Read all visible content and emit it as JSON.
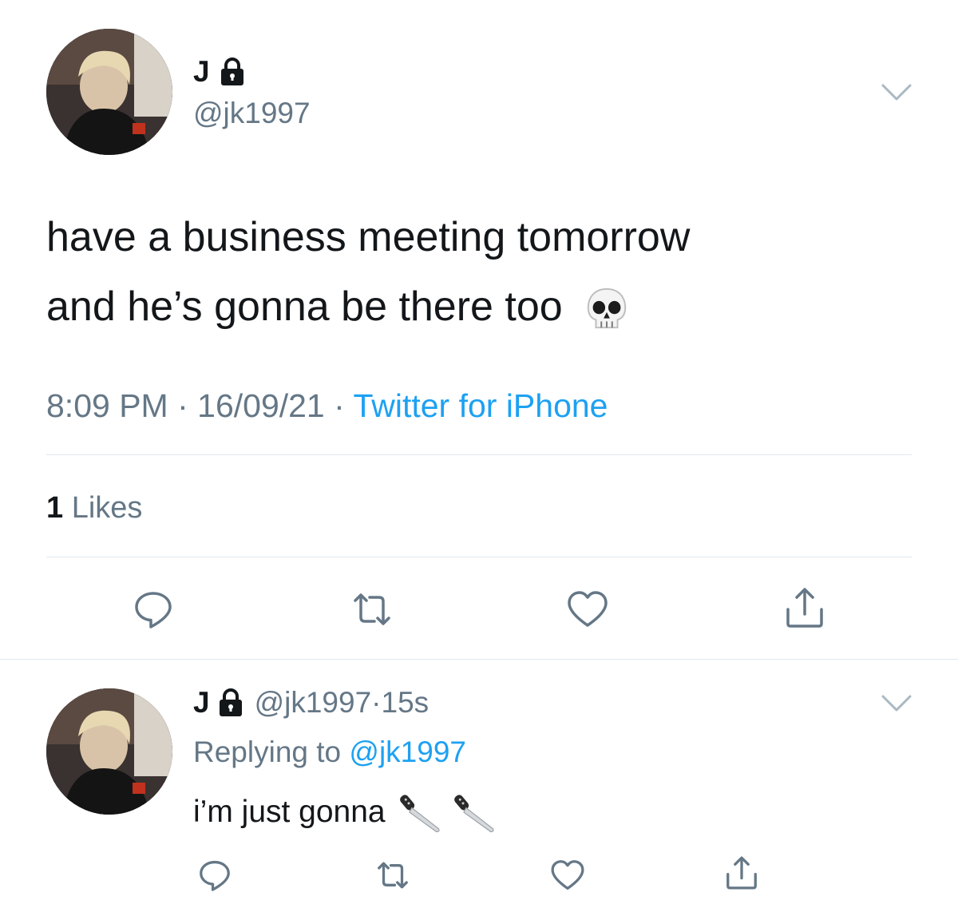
{
  "main_tweet": {
    "display_name": "J",
    "handle": "@jk1997",
    "text_line_1": "have a business meeting tomorrow",
    "text_line_2": "and he’s gonna be there too",
    "emoji": "skull-emoji",
    "time": "8:09 PM",
    "separator": " · ",
    "date": "16/09/21",
    "source": "Twitter for iPhone",
    "likes_count": "1",
    "likes_label": "Likes",
    "actions": [
      "reply-icon",
      "retweet-icon",
      "like-icon",
      "share-icon"
    ]
  },
  "reply_tweet": {
    "display_name": "J",
    "handle": "@jk1997",
    "separator": " · ",
    "age": "15s",
    "replying_label": "Replying to ",
    "replying_to": "@jk1997",
    "text": "i’m just gonna ",
    "emoji": [
      "knife-emoji",
      "knife-emoji"
    ],
    "actions": [
      "reply-icon",
      "retweet-icon",
      "like-icon",
      "share-icon"
    ]
  },
  "colors": {
    "text_primary": "#14171a",
    "text_secondary": "#657786",
    "link_blue": "#1da1f2",
    "divider": "#e1e8ed"
  }
}
